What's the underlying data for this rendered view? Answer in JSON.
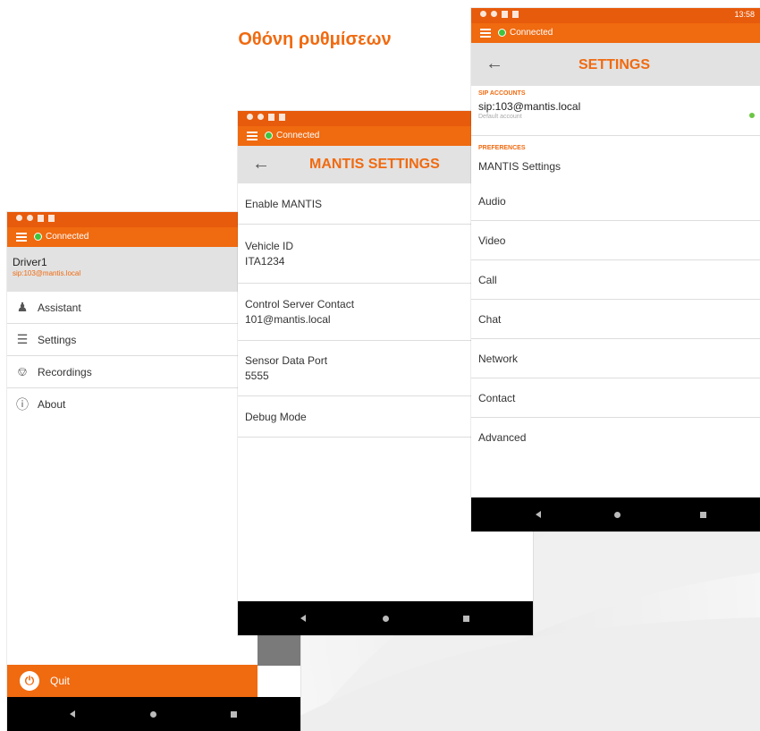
{
  "page_title": "Οθόνη ρυθμίσεων",
  "colors": {
    "accent": "#f06a10",
    "statusbar": "#e75b0c",
    "connected": "#3ec43e"
  },
  "status": {
    "connected_label": "Connected",
    "time": "13:58"
  },
  "drawer": {
    "user_name": "Driver1",
    "user_sip": "sip:103@mantis.local",
    "items": [
      {
        "label": "Assistant",
        "icon": "assistant-icon"
      },
      {
        "label": "Settings",
        "icon": "sliders-icon"
      },
      {
        "label": "Recordings",
        "icon": "microphone-icon"
      },
      {
        "label": "About",
        "icon": "info-icon"
      }
    ],
    "quit_label": "Quit"
  },
  "mantis_settings": {
    "title": "MANTIS SETTINGS",
    "enable_label": "Enable MANTIS",
    "vehicle_id_label": "Vehicle ID",
    "vehicle_id_value": "ITA1234",
    "control_server_label": "Control Server Contact",
    "control_server_value": "101@mantis.local",
    "sensor_port_label": "Sensor Data Port",
    "sensor_port_value": "5555",
    "debug_label": "Debug Mode"
  },
  "settings": {
    "title": "SETTINGS",
    "sip_section": "SIP ACCOUNTS",
    "account": "sip:103@mantis.local",
    "account_sub": "Default account",
    "pref_section": "PREFERENCES",
    "prefs": [
      "MANTIS Settings",
      "Audio",
      "Video",
      "Call",
      "Chat",
      "Network",
      "Contact",
      "Advanced"
    ]
  }
}
